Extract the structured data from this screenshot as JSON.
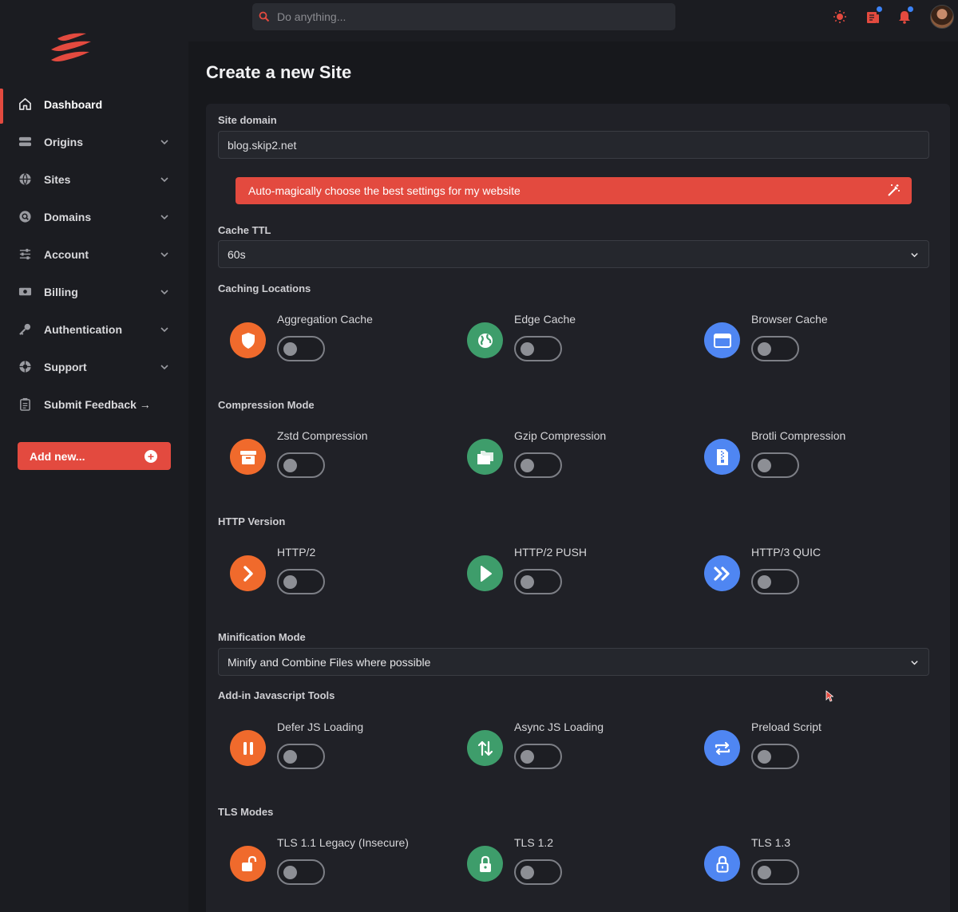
{
  "colors": {
    "accent": "#e34a3f",
    "orange": "#f06a2c",
    "green": "#3e9d6b",
    "blue": "#4f86f2",
    "toggle_off": "#8d8f95"
  },
  "search": {
    "placeholder": "Do anything..."
  },
  "topbar": {
    "icons": [
      "sun-icon",
      "news-icon",
      "bell-icon",
      "user-avatar"
    ]
  },
  "sidebar": {
    "items": [
      {
        "label": "Dashboard",
        "icon": "home-icon",
        "active": true,
        "expandable": false
      },
      {
        "label": "Origins",
        "icon": "server-icon",
        "expandable": true
      },
      {
        "label": "Sites",
        "icon": "globe-icon",
        "expandable": true
      },
      {
        "label": "Domains",
        "icon": "search-domain-icon",
        "expandable": true
      },
      {
        "label": "Account",
        "icon": "sliders-icon",
        "expandable": true
      },
      {
        "label": "Billing",
        "icon": "money-icon",
        "expandable": true
      },
      {
        "label": "Authentication",
        "icon": "key-icon",
        "expandable": true
      },
      {
        "label": "Support",
        "icon": "lifebuoy-icon",
        "expandable": true
      },
      {
        "label": "Submit Feedback →",
        "icon": "clipboard-icon",
        "expandable": false
      }
    ],
    "add_new": "Add new..."
  },
  "main": {
    "title": "Create a new Site",
    "site_domain": {
      "label": "Site domain",
      "value": "blog.skip2.net"
    },
    "magic_button": "Auto-magically choose the best settings for my website",
    "cache_ttl": {
      "label": "Cache TTL",
      "value": "60s"
    },
    "caching_locations": {
      "label": "Caching Locations",
      "options": [
        {
          "name": "Aggregation Cache",
          "icon": "shield-icon",
          "color": "orange",
          "enabled": false
        },
        {
          "name": "Edge Cache",
          "icon": "globe-icon",
          "color": "green",
          "enabled": false
        },
        {
          "name": "Browser Cache",
          "icon": "browser-window-icon",
          "color": "blue",
          "enabled": false
        }
      ]
    },
    "compression_mode": {
      "label": "Compression Mode",
      "options": [
        {
          "name": "Zstd Compression",
          "icon": "archive-box-icon",
          "color": "orange",
          "enabled": false
        },
        {
          "name": "Gzip Compression",
          "icon": "folders-icon",
          "color": "green",
          "enabled": false
        },
        {
          "name": "Brotli Compression",
          "icon": "zip-file-icon",
          "color": "blue",
          "enabled": false
        }
      ]
    },
    "http_version": {
      "label": "HTTP Version",
      "options": [
        {
          "name": "HTTP/2",
          "icon": "chevron-right-icon",
          "color": "orange",
          "enabled": false
        },
        {
          "name": "HTTP/2 PUSH",
          "icon": "play-icon",
          "color": "green",
          "enabled": false
        },
        {
          "name": "HTTP/3 QUIC",
          "icon": "double-chevron-right-icon",
          "color": "blue",
          "enabled": false
        }
      ]
    },
    "minification_mode": {
      "label": "Minification Mode",
      "value": "Minify and Combine Files where possible"
    },
    "js_tools": {
      "label": "Add-in Javascript Tools",
      "options": [
        {
          "name": "Defer JS Loading",
          "icon": "pause-icon",
          "color": "orange",
          "enabled": false
        },
        {
          "name": "Async JS Loading",
          "icon": "up-down-arrows-icon",
          "color": "green",
          "enabled": false
        },
        {
          "name": "Preload Script",
          "icon": "repeat-arrows-icon",
          "color": "blue",
          "enabled": false
        }
      ]
    },
    "tls_modes": {
      "label": "TLS Modes",
      "options": [
        {
          "name": "TLS 1.1 Legacy (Insecure)",
          "icon": "unlock-icon",
          "color": "orange",
          "enabled": false
        },
        {
          "name": "TLS 1.2",
          "icon": "lock-icon",
          "color": "green",
          "enabled": false
        },
        {
          "name": "TLS 1.3",
          "icon": "lock-outline-icon",
          "color": "blue",
          "enabled": false
        }
      ]
    }
  }
}
